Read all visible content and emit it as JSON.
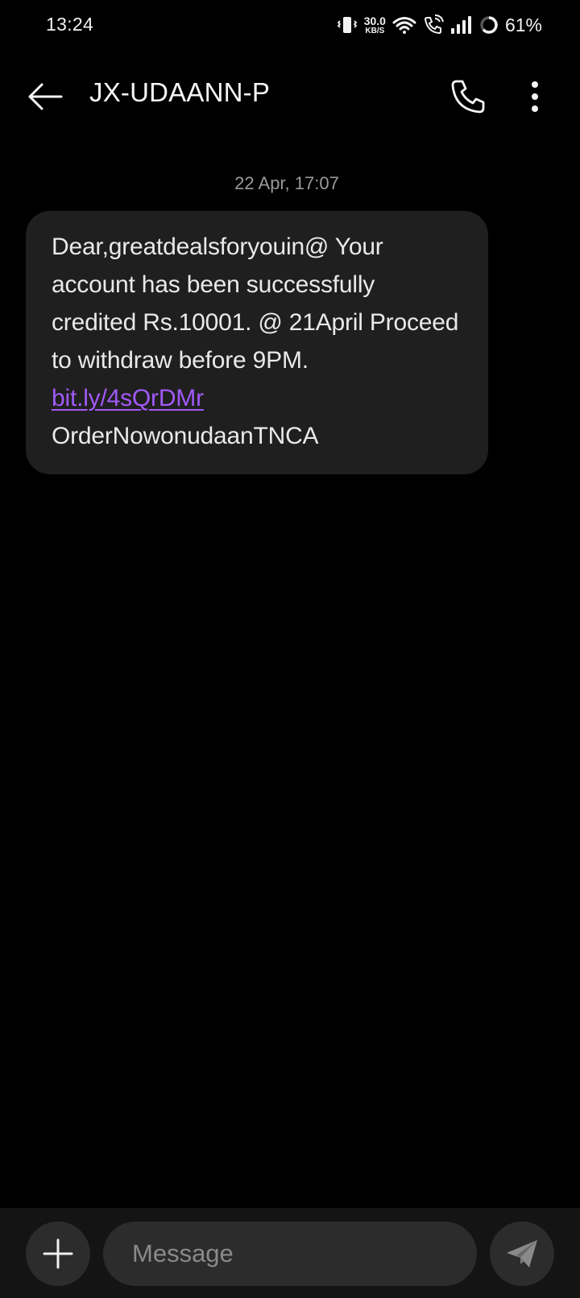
{
  "status_bar": {
    "time": "13:24",
    "network_speed_value": "30.0",
    "network_speed_unit": "KB/S",
    "battery_percent": "61%",
    "icons": [
      "vibrate-icon",
      "wifi-icon",
      "wifi-calling-icon",
      "signal-icon",
      "battery-icon"
    ]
  },
  "header": {
    "title": "JX-UDAANN-P",
    "icons": [
      "back-arrow-icon",
      "phone-icon",
      "more-vert-icon"
    ]
  },
  "conversation": {
    "timestamp": "22 Apr, 17:07",
    "message": {
      "text_before_link": "Dear,greatdealsforyouin@ Your account has been successfully credited Rs.10001. @ 21April Proceed to withdraw before 9PM. ",
      "link_text": "bit.ly/4sQrDMr",
      "text_after_link": " OrderNowonudaanTNCA"
    }
  },
  "composer": {
    "placeholder": "Message",
    "value": "",
    "icons": [
      "plus-icon",
      "send-icon"
    ]
  },
  "colors": {
    "background": "#000000",
    "bubble": "#1f1f1f",
    "link": "#a259f7",
    "composer_bar": "#141414",
    "control": "#2c2c2c"
  }
}
